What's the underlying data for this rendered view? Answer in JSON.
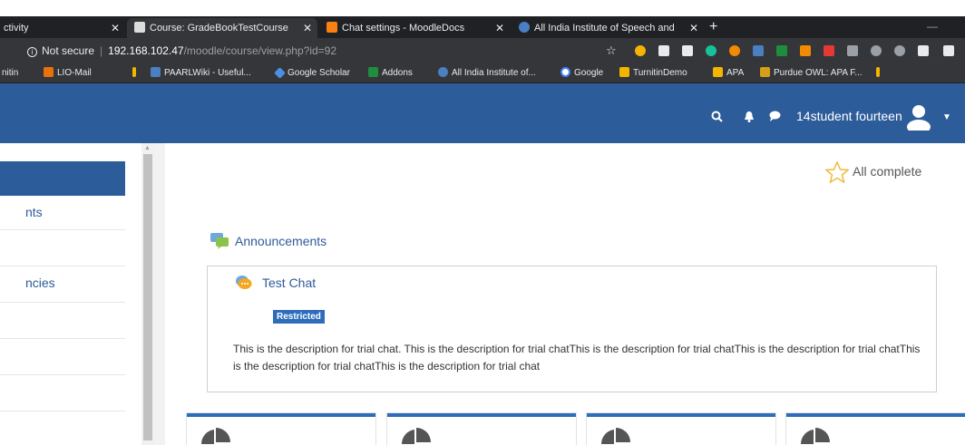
{
  "browser": {
    "tabs": [
      {
        "title": "ctivity",
        "close": "✕"
      },
      {
        "title": "Course: GradeBookTestCourse",
        "close": "✕"
      },
      {
        "title": "Chat settings - MoodleDocs",
        "close": "✕"
      },
      {
        "title": "All India Institute of Speech and",
        "close": "✕"
      }
    ],
    "new_tab": "+",
    "address": {
      "security_label": "Not secure",
      "host": "192.168.102.47",
      "path": "/moodle/course/view.php?id=92"
    },
    "bookmarks": [
      "nitin",
      "LIO-Mail",
      "PAARLWiki - Useful...",
      "Google Scholar",
      "Addons",
      "All India Institute of...",
      "Google",
      "TurnitinDemo",
      "APA",
      "Purdue OWL: APA F..."
    ]
  },
  "navbar": {
    "username": "14student fourteen"
  },
  "drawer": {
    "items": [
      "nts",
      "",
      "ncies",
      "",
      "",
      ""
    ]
  },
  "main": {
    "completion_label": "All complete",
    "section_title": "Announcements",
    "activity": {
      "title": "Test Chat",
      "badge": "Restricted",
      "description": "This is the description for trial chat. This is the description for trial chatThis is the description for trial chatThis is the description for trial chatThis is the description for trial chatThis is the description for trial chat"
    }
  },
  "colors": {
    "brand": "#2d5c9a",
    "badge": "#2d6dbb",
    "browser_dark": "#202124",
    "browser_toolbar": "#35363a"
  }
}
